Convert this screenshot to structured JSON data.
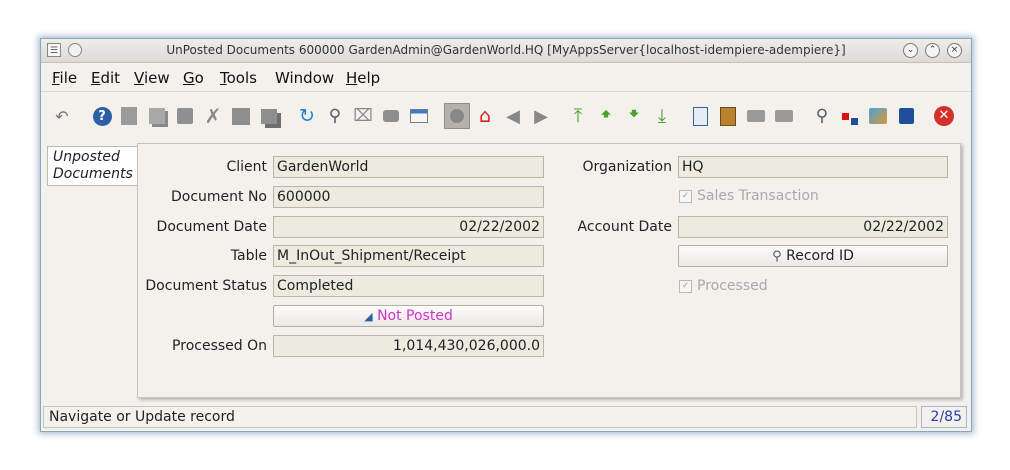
{
  "window": {
    "title": "UnPosted Documents  600000  GardenAdmin@GardenWorld.HQ [MyAppsServer{localhost-idempiere-adempiere}]"
  },
  "menu": [
    {
      "key": "F",
      "rest": "ile"
    },
    {
      "key": "E",
      "rest": "dit"
    },
    {
      "key": "V",
      "rest": "iew"
    },
    {
      "key": "G",
      "rest": "o"
    },
    {
      "key": "T",
      "rest": "ools"
    },
    {
      "key": "",
      "rest": "Window"
    },
    {
      "key": "H",
      "rest": "elp"
    }
  ],
  "tab": {
    "label": "Unposted Documents"
  },
  "fields": {
    "client": {
      "label": "Client",
      "value": "GardenWorld"
    },
    "organization": {
      "label": "Organization",
      "value": "HQ"
    },
    "document_no": {
      "label": "Document No",
      "value": "600000"
    },
    "sales_transaction": {
      "label": "Sales Transaction",
      "checked": true
    },
    "document_date": {
      "label": "Document Date",
      "value": "02/22/2002"
    },
    "account_date": {
      "label": "Account Date",
      "value": "02/22/2002"
    },
    "table": {
      "label": "Table",
      "value": "M_InOut_Shipment/Receipt"
    },
    "record_id": {
      "label": "Record ID"
    },
    "document_status": {
      "label": "Document Status",
      "value": "Completed"
    },
    "processed": {
      "label": "Processed",
      "checked": true
    },
    "posted": {
      "label": "Not Posted",
      "color": "#cc33cc"
    },
    "processed_on": {
      "label": "Processed On",
      "value": "1,014,430,026,000.0"
    }
  },
  "status": {
    "message": "Navigate or Update record",
    "record_count": "2/85"
  },
  "colors": {
    "field_bg": "#ebebdf",
    "window_bg": "#f3f1ec",
    "posted_text": "#cc33cc",
    "count_text": "#2a3bb3"
  }
}
